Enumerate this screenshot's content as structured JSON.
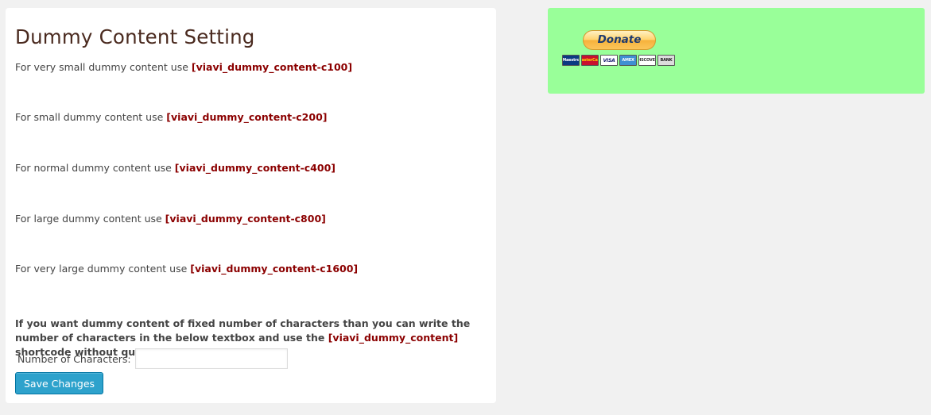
{
  "settings": {
    "title": "Dummy Content Setting",
    "usage": [
      {
        "text": "For very small dummy content use ",
        "code": "[viavi_dummy_content-c100]"
      },
      {
        "text": "For small dummy content use ",
        "code": "[viavi_dummy_content-c200]"
      },
      {
        "text": "For normal dummy content use ",
        "code": "[viavi_dummy_content-c400]"
      },
      {
        "text": "For large dummy content use ",
        "code": "[viavi_dummy_content-c800]"
      },
      {
        "text": "For very large dummy content use ",
        "code": "[viavi_dummy_content-c1600]"
      }
    ],
    "intro": {
      "before": "If you want dummy content of fixed number of characters than you can write the number of characters in the below textbox and use the ",
      "code": "[viavi_dummy_content]",
      "after": " shortcode without quotes."
    },
    "field": {
      "label": "Number of Characters:",
      "value": "",
      "placeholder": ""
    },
    "save_label": "Save Changes"
  },
  "donate": {
    "button_label": "Donate",
    "cards": [
      {
        "icon": "maestro-icon",
        "label": "Maestro"
      },
      {
        "icon": "mastercard-icon",
        "label": "MasterCard"
      },
      {
        "icon": "visa-icon",
        "label": "VISA"
      },
      {
        "icon": "amex-icon",
        "label": "AMEX"
      },
      {
        "icon": "discover-icon",
        "label": "DISCOVER"
      },
      {
        "icon": "bank-icon",
        "label": "BANK"
      }
    ]
  },
  "colors": {
    "page_bg": "#f1f1f1",
    "panel_bg": "#ffffff",
    "donate_bg": "#99ff99",
    "code_text": "#8b0000",
    "button_bg": "#2ea2cc"
  }
}
